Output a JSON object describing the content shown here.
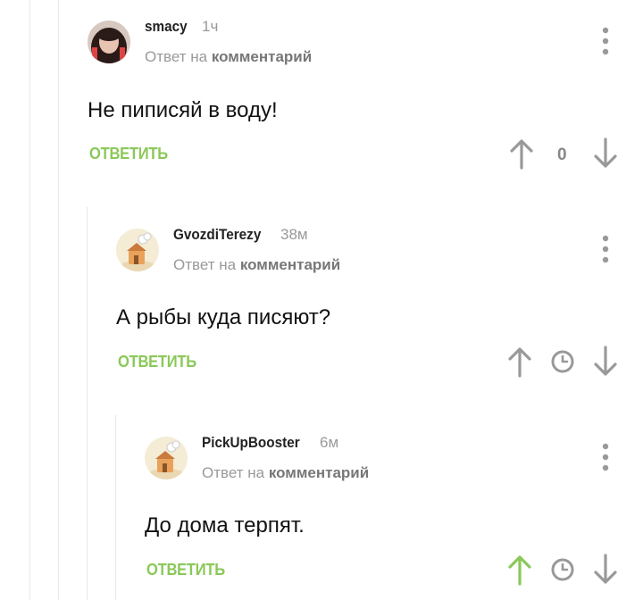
{
  "comments": [
    {
      "author": "smacy",
      "time": "1ч",
      "reply_prefix": "Ответ на",
      "reply_link": "комментарий",
      "text": "Не пиписяй в воду!",
      "reply_label": "ОТВЕТИТЬ",
      "score": "0",
      "upvote_color": "#999999"
    },
    {
      "author": "GvozdiTerezy",
      "time": "38м",
      "reply_prefix": "Ответ на",
      "reply_link": "комментарий",
      "text": "А рыбы куда писяют?",
      "reply_label": "ОТВЕТИТЬ",
      "upvote_color": "#999999"
    },
    {
      "author": "PickUpBooster",
      "time": "6м",
      "reply_prefix": "Ответ на",
      "reply_link": "комментарий",
      "text": "До дома терпят.",
      "reply_label": "ОТВЕТИТЬ",
      "upvote_color": "#8ac858"
    }
  ],
  "colors": {
    "accent": "#8ac858",
    "muted": "#999999",
    "thread_line": "#e6e6e6"
  }
}
